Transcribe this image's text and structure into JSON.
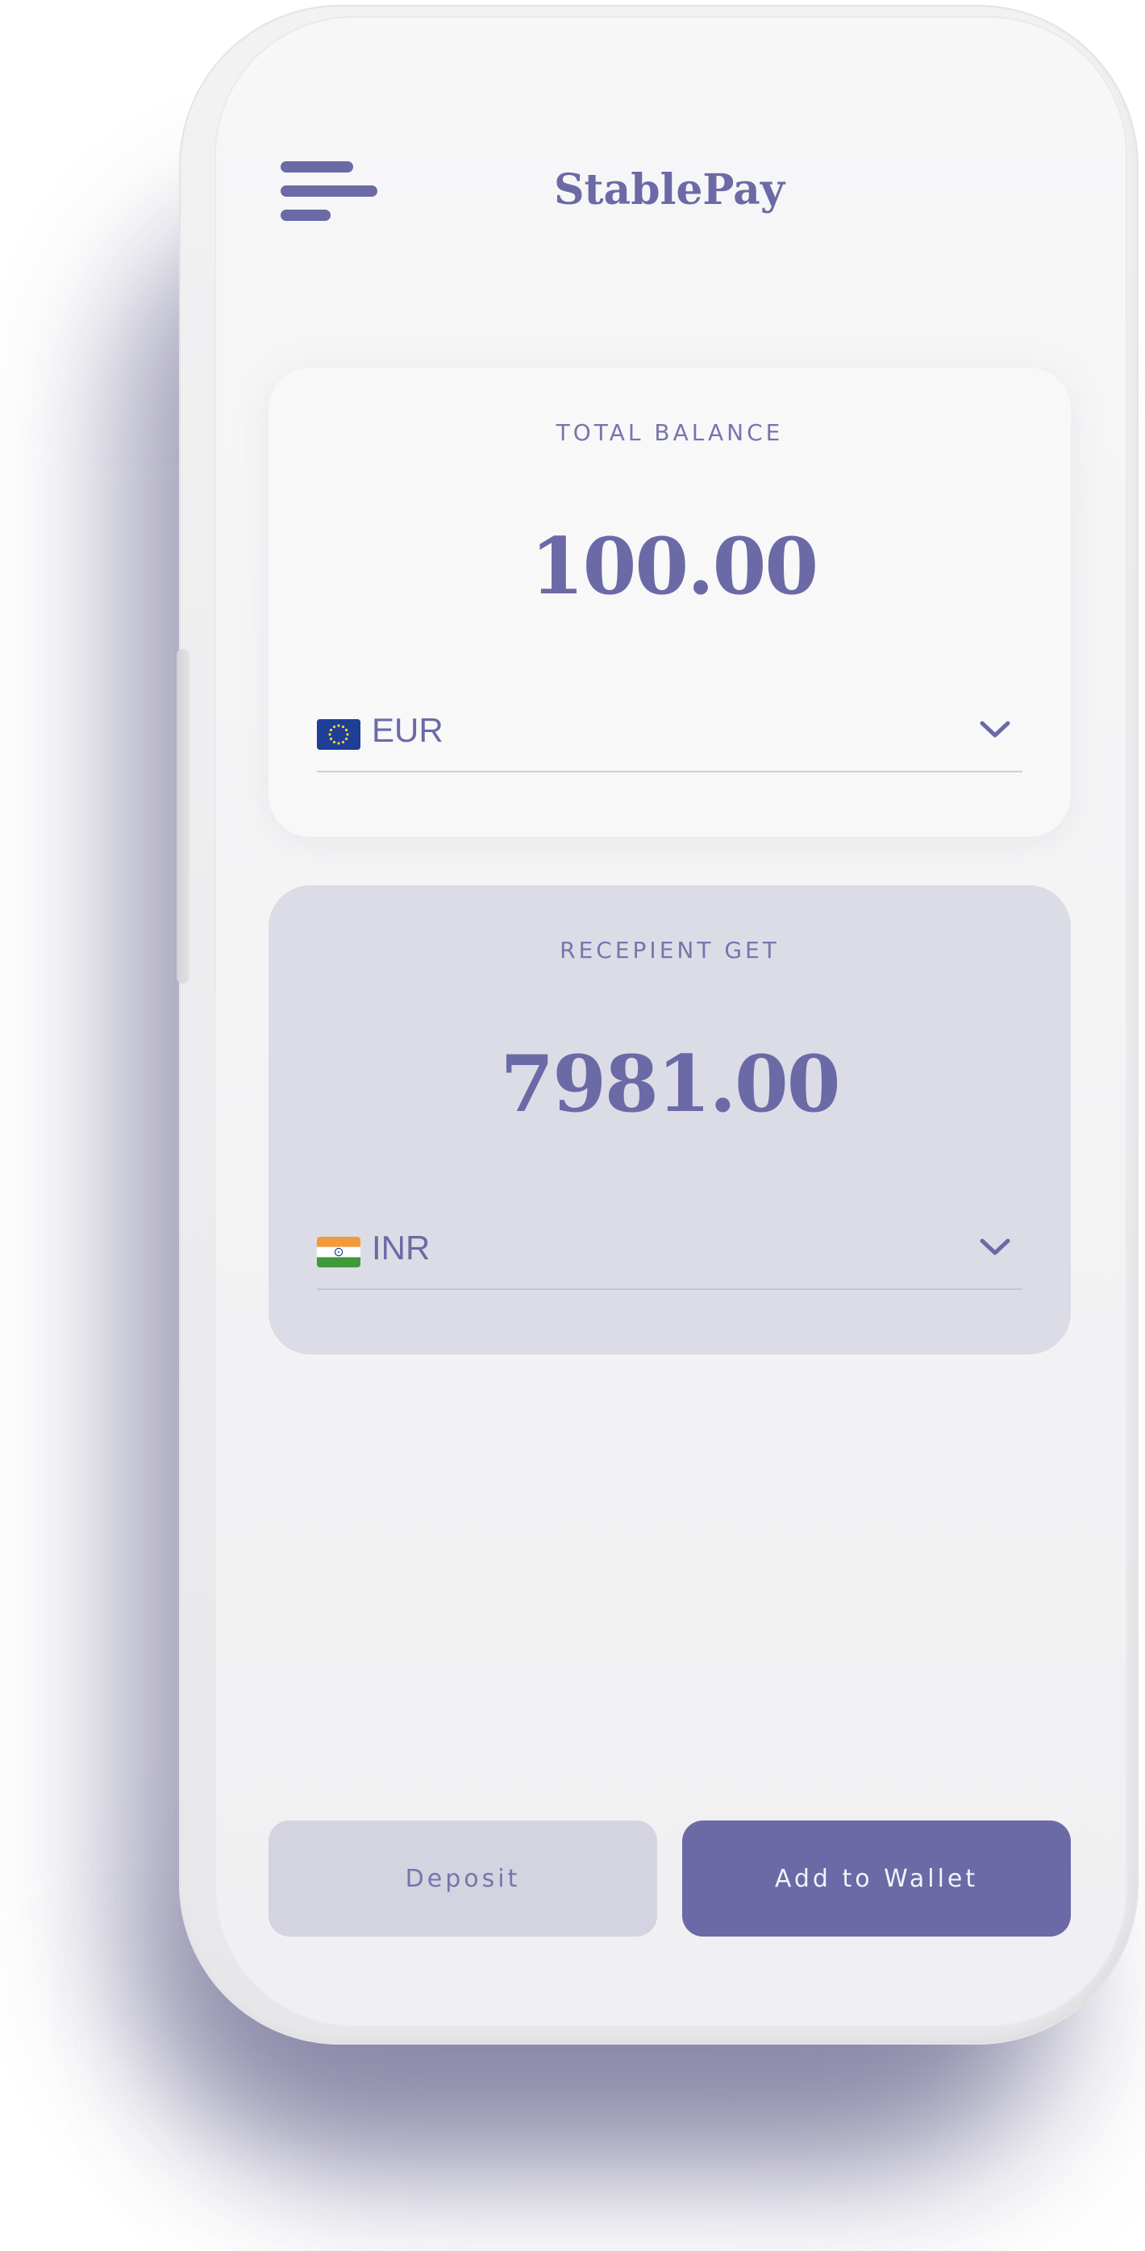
{
  "header": {
    "menu_icon": "hamburger-menu-icon",
    "brand": "StablePay"
  },
  "balance_card": {
    "label": "TOTAL BALANCE",
    "amount": "100.00",
    "currency": {
      "flag_icon": "eu-flag-icon",
      "code": "EUR",
      "chevron_icon": "chevron-down-icon"
    }
  },
  "recipient_card": {
    "label": "RECEPIENT GET",
    "amount": "7981.00",
    "currency": {
      "flag_icon": "india-flag-icon",
      "code": "INR",
      "chevron_icon": "chevron-down-icon"
    }
  },
  "actions": {
    "deposit_label": "Deposit",
    "add_to_wallet_label": "Add to Wallet"
  },
  "colors": {
    "accent": "#6b6aa6",
    "recipient_card_bg": "#dbdce6",
    "deposit_button_bg": "#d3d4df",
    "screen_bg": "#f4f4f6"
  }
}
